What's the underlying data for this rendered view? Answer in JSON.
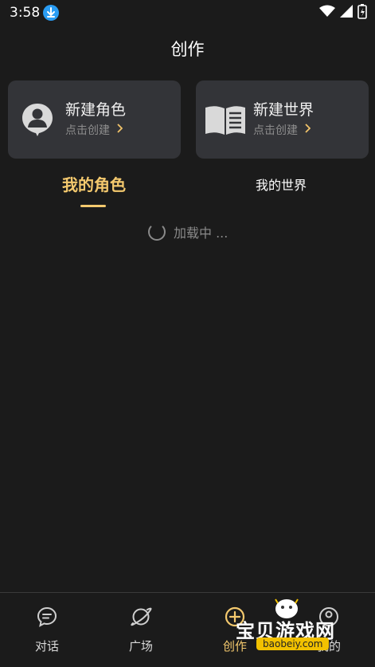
{
  "status_bar": {
    "time": "3:58"
  },
  "header": {
    "title": "创作"
  },
  "cards": [
    {
      "title": "新建角色",
      "subtitle": "点击创建",
      "icon": "person-icon"
    },
    {
      "title": "新建世界",
      "subtitle": "点击创建",
      "icon": "book-icon"
    }
  ],
  "tabs": [
    {
      "label": "我的角色",
      "active": true
    },
    {
      "label": "我的世界",
      "active": false
    }
  ],
  "loading": {
    "text": "加载中 ..."
  },
  "bottom_nav": [
    {
      "label": "对话",
      "icon": "chat-icon",
      "active": false
    },
    {
      "label": "广场",
      "icon": "planet-icon",
      "active": false
    },
    {
      "label": "创作",
      "icon": "create-plus-icon",
      "active": true
    },
    {
      "label": "我的",
      "icon": "profile-icon",
      "active": false
    }
  ],
  "watermark": {
    "text": "宝贝游戏网",
    "url": "baobeiy.com"
  },
  "colors": {
    "background": "#1b1b1b",
    "card": "#333438",
    "accent": "#f4c96e",
    "muted": "#8d8d8d"
  }
}
